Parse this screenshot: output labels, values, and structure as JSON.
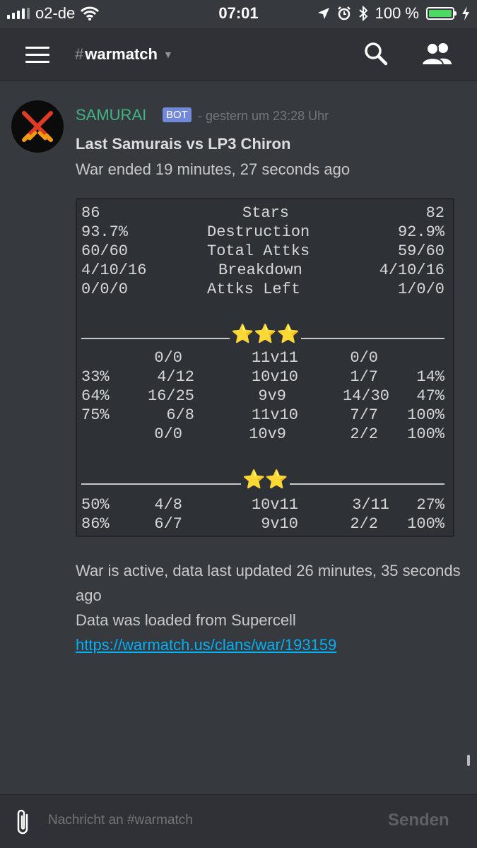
{
  "status_bar": {
    "carrier": "o2-de",
    "time": "07:01",
    "battery": "100 %",
    "battery_level_percent": 100,
    "icons": [
      "signal-icon",
      "wifi-icon",
      "location-icon",
      "alarm-icon",
      "bluetooth-icon",
      "battery-icon",
      "charging-icon"
    ]
  },
  "header": {
    "hash": "#",
    "channel": "warmatch",
    "icons": [
      "hamburger-menu-icon",
      "chevron-down-icon",
      "search-icon",
      "members-icon"
    ]
  },
  "message": {
    "author": "SAMURAI",
    "bot_tag": "BOT",
    "timestamp": "- gestern um 23:28 Uhr",
    "title": "Last Samurais vs LP3 Chiron",
    "subtitle": "War ended 19 minutes, 27 seconds ago",
    "summary_rows": [
      {
        "left": "86",
        "label": "Stars",
        "right": "82"
      },
      {
        "left": "93.7%",
        "label": "Destruction",
        "right": "92.9%"
      },
      {
        "left": "60/60",
        "label": "Total Attks",
        "right": "59/60"
      },
      {
        "left": "4/10/16",
        "label": "Breakdown",
        "right": "4/10/16"
      },
      {
        "left": "0/0/0",
        "label": "Attks Left",
        "right": "1/0/0"
      }
    ],
    "three_star": {
      "stars": "⭐⭐⭐",
      "rows": [
        {
          "lp": "",
          "lr": "0/0",
          "mid": "11v11",
          "rr": "0/0",
          "rp": ""
        },
        {
          "lp": "33%",
          "lr": "4/12",
          "mid": "10v10",
          "rr": "1/7",
          "rp": "14%"
        },
        {
          "lp": "64%",
          "lr": "16/25",
          "mid": "9v9",
          "rr": "14/30",
          "rp": "47%"
        },
        {
          "lp": "75%",
          "lr": "6/8",
          "mid": "11v10",
          "rr": "7/7",
          "rp": "100%"
        },
        {
          "lp": "",
          "lr": "0/0",
          "mid": "10v9",
          "rr": "2/2",
          "rp": "100%"
        }
      ]
    },
    "two_star": {
      "stars": "⭐⭐",
      "rows": [
        {
          "lp": "50%",
          "lr": "4/8",
          "mid": "10v11",
          "rr": "3/11",
          "rp": "27%"
        },
        {
          "lp": "86%",
          "lr": "6/7",
          "mid": "9v10",
          "rr": "2/2",
          "rp": "100%"
        }
      ]
    },
    "footer_line1": "War is active, data last updated 26 minutes, 35 seconds ago",
    "footer_line2": "Data was loaded from Supercell",
    "footer_link": "https://warmatch.us/clans/war/193159"
  },
  "input": {
    "placeholder": "Nachricht an #warmatch",
    "value": "",
    "send_label": "Senden",
    "icons": [
      "attachment-icon"
    ]
  },
  "colors": {
    "background": "#36393e",
    "header": "#2f3136",
    "author": "#43b581",
    "bot_tag": "#7289da",
    "link": "#00b0f4",
    "battery": "#4cd964"
  }
}
